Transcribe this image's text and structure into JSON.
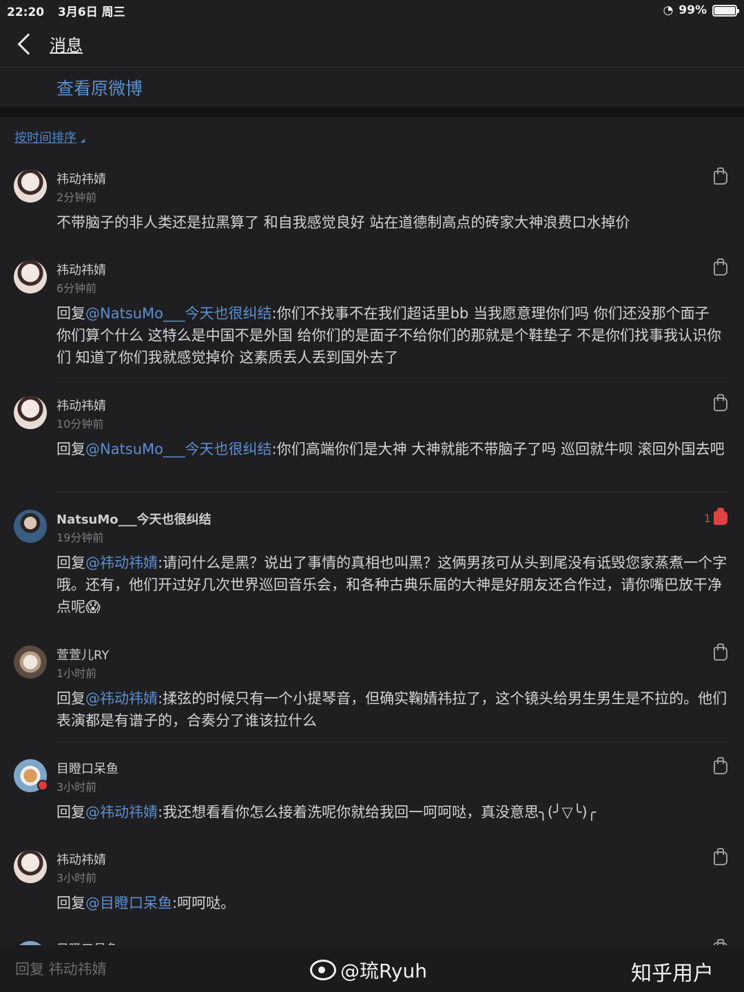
{
  "status_bar": {
    "time": "22:20",
    "date": "3月6日 周三",
    "battery": "99%",
    "battery_level": 0.99
  },
  "nav": {
    "title": "消息"
  },
  "view_original": "查看原微博",
  "sort_label": "按时间排序",
  "comments": [
    {
      "name": "祎动祎婧",
      "time": "2分钟前",
      "text": "不带脑子的非人类还是拉黑算了 和自我感觉良好 站在道德制高点的砖家大神浪费口水掉价"
    },
    {
      "name": "祎动祎婧",
      "time": "6分钟前",
      "prefix": "回复",
      "mention": "@NatsuMo___今天也很纠结",
      "text": ":你们不找事不在我们超话里bb 当我愿意理你们吗 你们还没那个面子 你们算个什么 这特么是中国不是外国 给你们的是面子不给你们的那就是个鞋垫子 不是你们找事我认识你们 知道了你们我就感觉掉价 这素质丢人丢到国外去了"
    },
    {
      "name": "祎动祎婧",
      "time": "10分钟前",
      "prefix": "回复",
      "mention": "@NatsuMo___今天也很纠结",
      "text": ":你们高端你们是大神 大神就能不带脑子了吗 巡回就牛呗 滚回外国去吧"
    },
    {
      "name": "NatsuMo___今天也很纠结",
      "time": "19分钟前",
      "likes": "1",
      "prefix": "回复",
      "mention": "@祎动祎婧",
      "text": ":请问什么是黑？说出了事情的真相也叫黑？这俩男孩可从头到尾没有诋毁您家蒸煮一个字哦。还有，他们开过好几次世界巡回音乐会，和各种古典乐届的大神是好朋友还合作过，请你嘴巴放干净点呢😱"
    },
    {
      "name": "萱萱儿RY",
      "time": "1小时前",
      "prefix": "回复",
      "mention": "@祎动祎婧",
      "text": ":揉弦的时候只有一个小提琴音，但确实鞠婧祎拉了，这个镜头给男生男生是不拉的。他们表演都是有谱子的，合奏分了谁该拉什么"
    },
    {
      "name": "目瞪口呆鱼",
      "time": "3小时前",
      "prefix": "回复",
      "mention": "@祎动祎婧",
      "text": ":我还想看看你怎么接着洗呢你就给我回一呵呵哒，真没意思╮(╯▽╰)╭"
    },
    {
      "name": "祎动祎婧",
      "time": "3小时前",
      "prefix": "回复",
      "mention": "@目瞪口呆鱼",
      "text": ":呵呵哒。"
    },
    {
      "name": "目瞪口呆鱼"
    }
  ],
  "reply_bar": {
    "placeholder": "回复 祎动祎婧"
  },
  "watermarks": {
    "weibo": "@琉Ryuh",
    "zhihu": "知乎用户"
  }
}
